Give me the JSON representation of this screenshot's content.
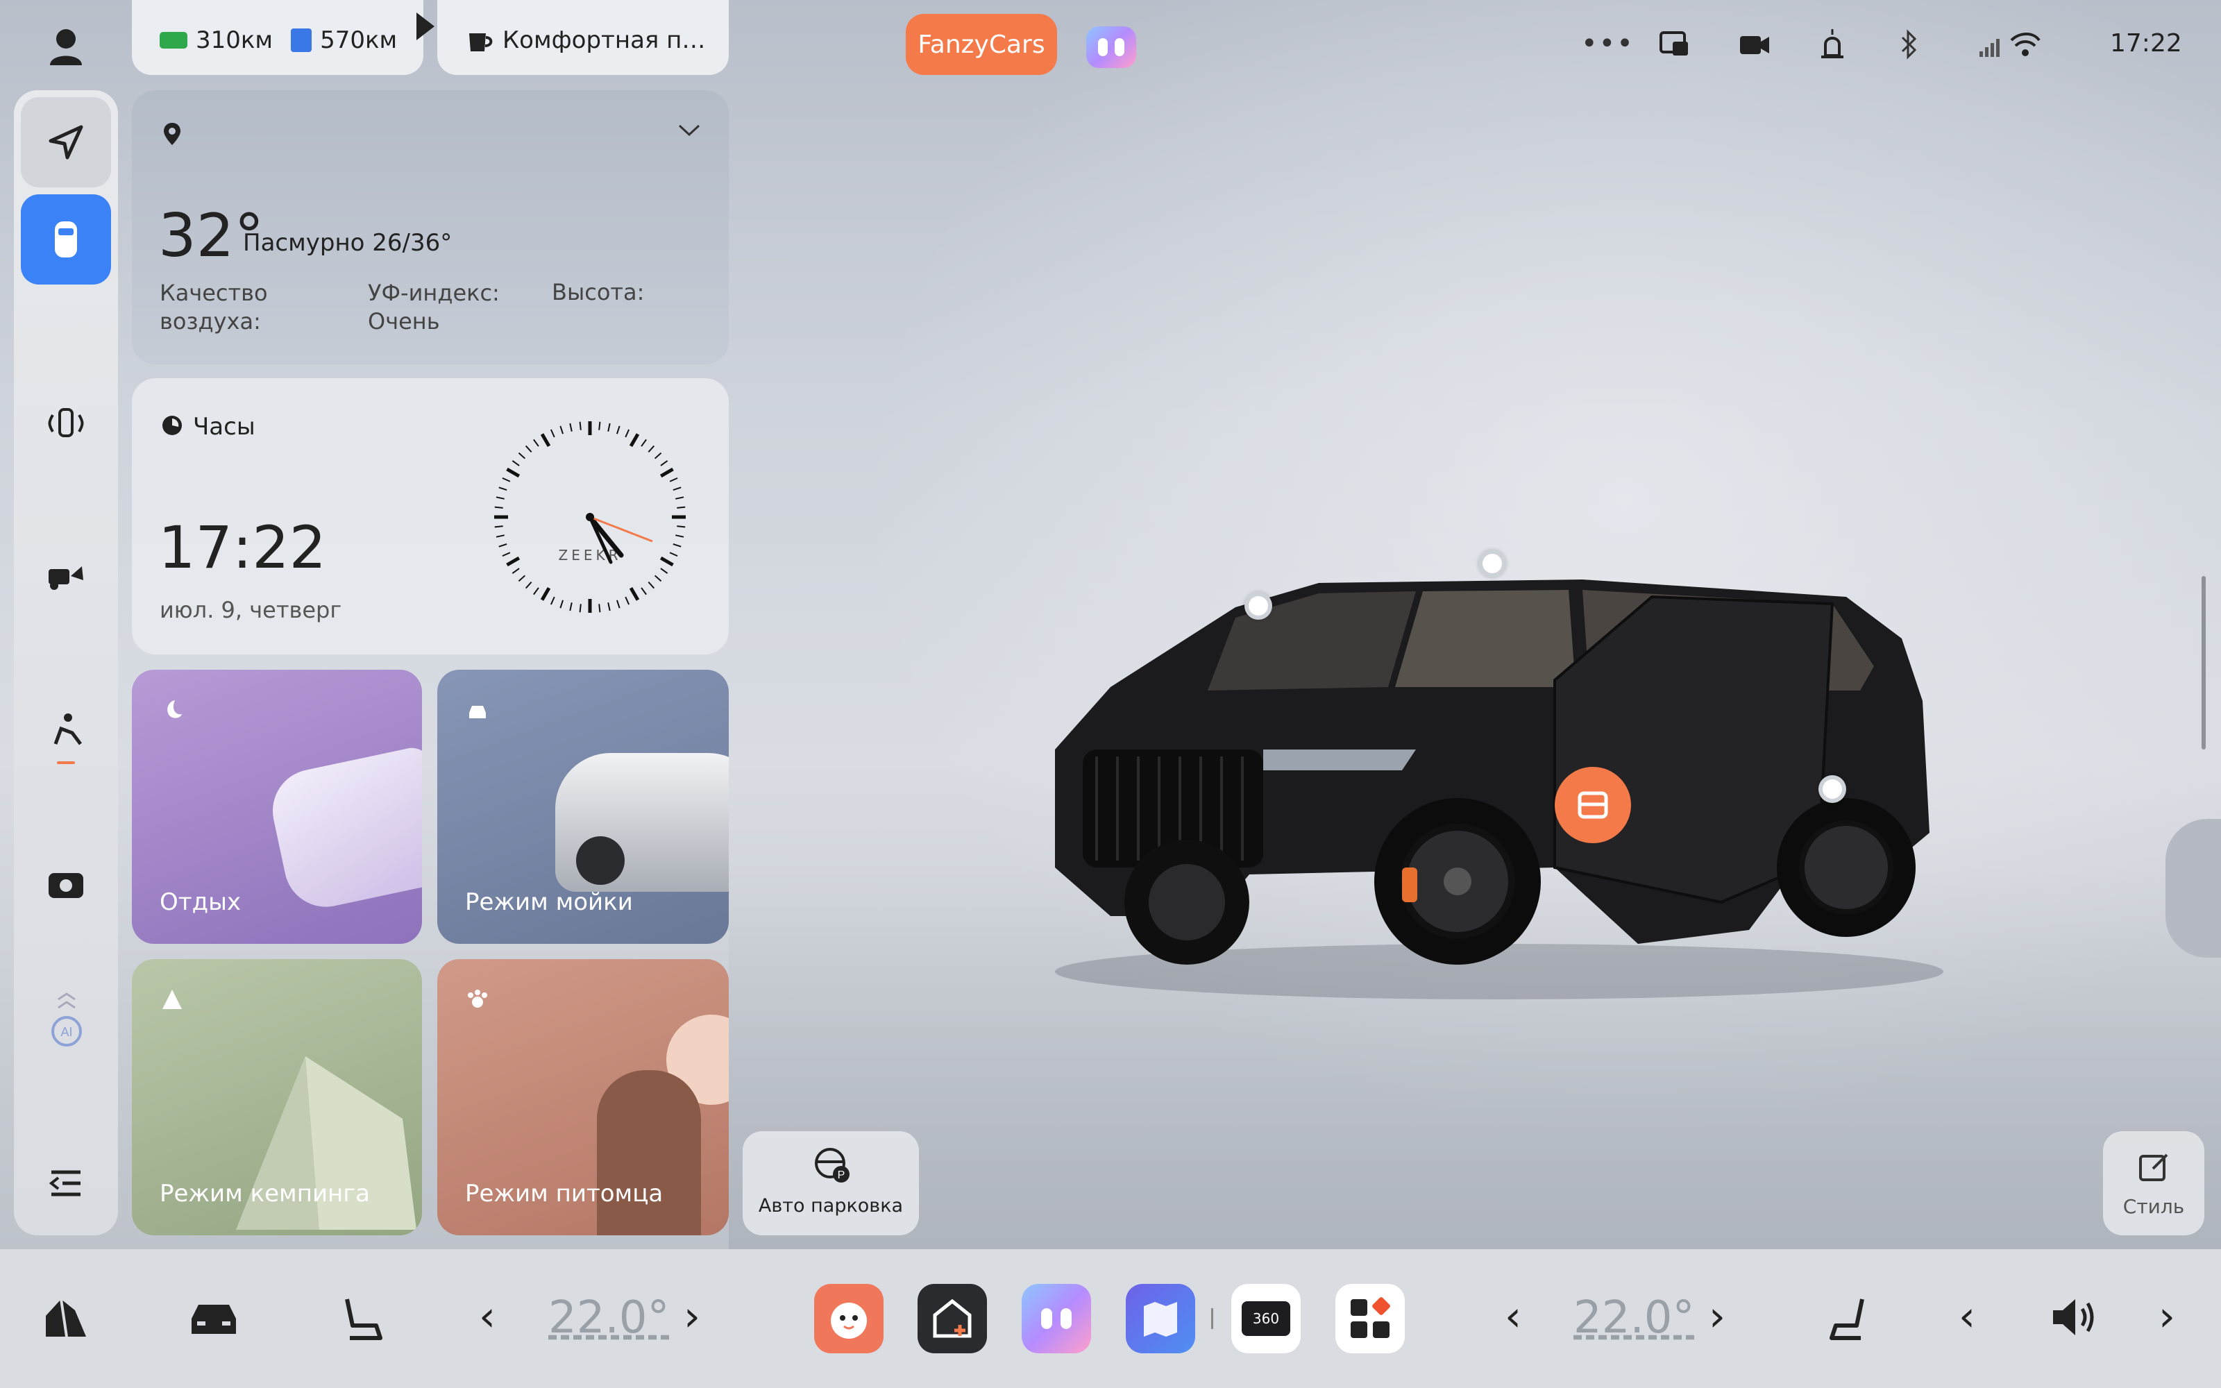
{
  "status": {
    "battery_range": "310км",
    "fuel_range": "570км",
    "mode_label": "Комфортная п…",
    "brand_button": "FanzyCars",
    "time": "17:22"
  },
  "weather": {
    "temp": "32°",
    "summary": "Пасмурно 26/36°",
    "air_quality_label": "Качество воздуха:",
    "uv_label": "УФ-индекс: Очень",
    "altitude_label": "Высота:"
  },
  "clock": {
    "title": "Часы",
    "time": "17:22",
    "date": "июл. 9, четверг",
    "brand": "ZEEKR"
  },
  "tiles": [
    {
      "label": "Отдых"
    },
    {
      "label": "Режим мойки"
    },
    {
      "label": "Режим кемпинга"
    },
    {
      "label": "Режим питомца"
    }
  ],
  "auto_parking": {
    "label": "Авто парковка"
  },
  "style_button": {
    "label": "Стиль"
  },
  "climate": {
    "left_temp": "22.0°",
    "right_temp": "22.0°"
  },
  "dock_360_label": "360",
  "colors": {
    "accent_orange": "#f47a4a",
    "accent_blue": "#3b82f6",
    "tile_rest": "#a88fc9",
    "tile_wash": "#7e8cae",
    "tile_camping": "#a8b896",
    "tile_pet": "#c4897a"
  }
}
